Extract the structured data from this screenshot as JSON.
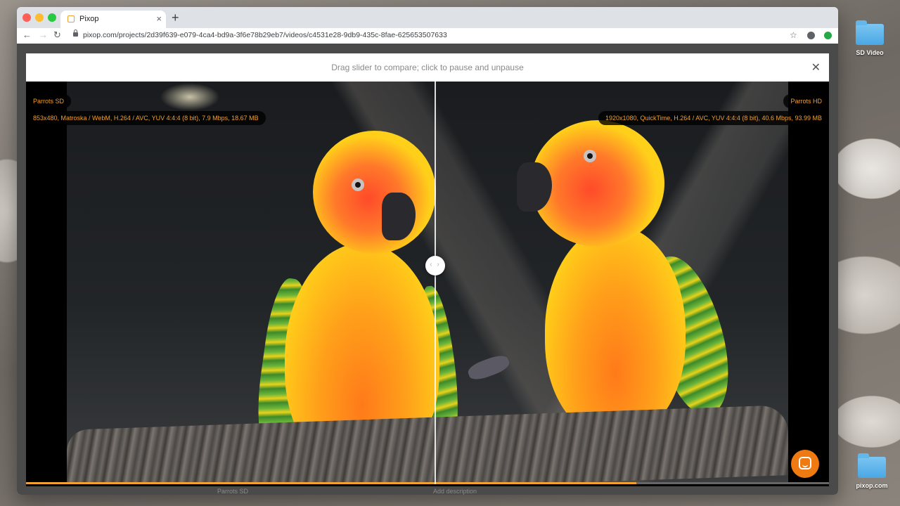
{
  "desktop": {
    "icons": [
      {
        "label": "SD Video"
      },
      {
        "label": "pixop.com"
      }
    ]
  },
  "browser": {
    "tab": {
      "title": "Pixop"
    },
    "new_tab": "+",
    "tab_close": "×",
    "nav": {
      "back": "←",
      "forward": "→",
      "reload": "↻"
    },
    "url": "pixop.com/projects/2d39f639-e079-4ca4-bd9a-3f6e78b29eb7/videos/c4531e28-9db9-435c-8fae-625653507633",
    "star": "☆"
  },
  "modal": {
    "hint": "Drag slider to compare; click to pause and unpause",
    "close": "✕",
    "left": {
      "name": "Parrots SD",
      "meta": "853x480, Matroska / WebM, H.264 / AVC, YUV 4:4:4 (8 bit), 7.9 Mbps, 18.67 MB"
    },
    "right": {
      "name": "Parrots HD",
      "meta": "1920x1080, QuickTime, H.264 / AVC, YUV 4:4:4 (8 bit), 40.6 Mbps, 93.99 MB"
    },
    "handle_arrows": "‹ ›",
    "slider_position": 0.51,
    "playback_progress": 0.76
  },
  "behind_modal": {
    "left_text": "Parrots SD",
    "right_text": "Add description"
  },
  "colors": {
    "accent": "#f0a030",
    "chat": "#f07a12"
  }
}
